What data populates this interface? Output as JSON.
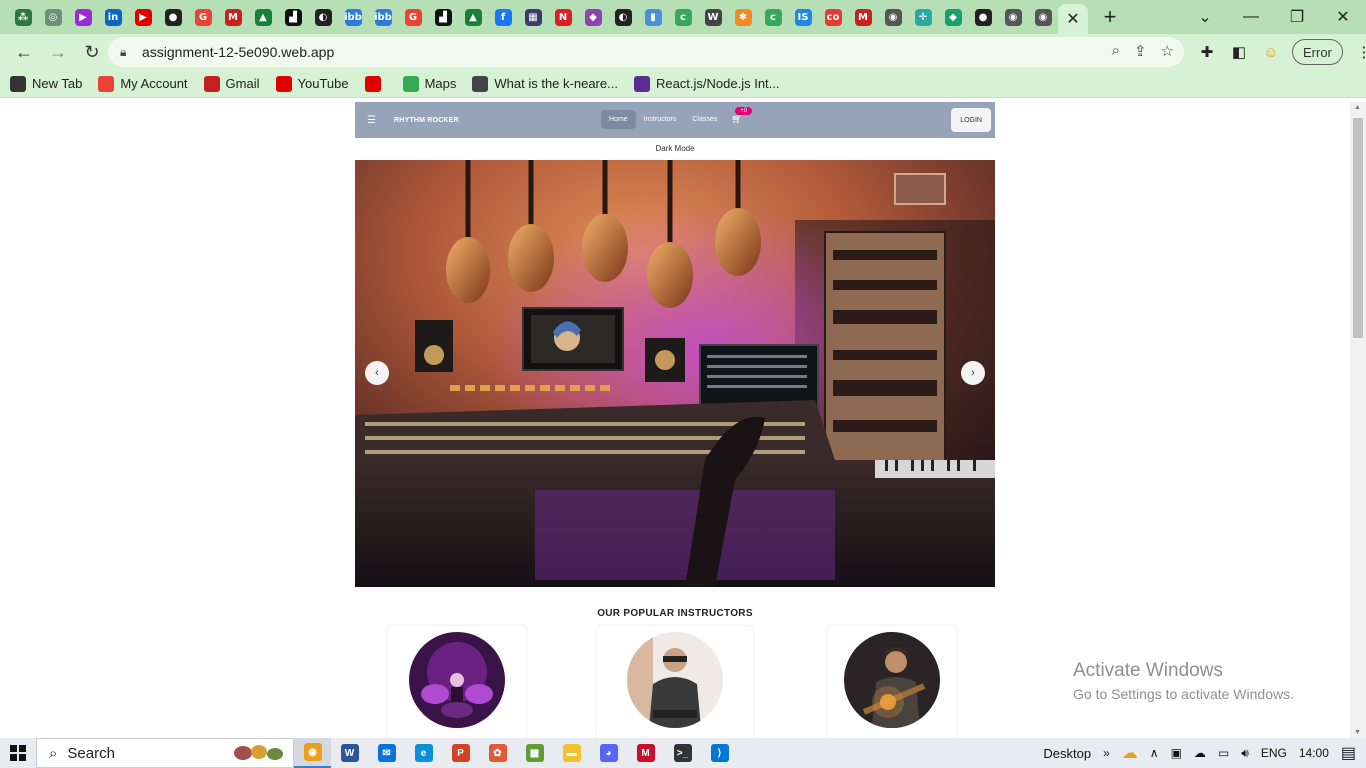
{
  "browser": {
    "tabs_favicons": [
      {
        "name": "ai-tab-icon",
        "color": "#2b7a3d",
        "glyph": "⁂"
      },
      {
        "name": "chatgpt-tab-icon",
        "color": "#6b8f78",
        "glyph": "◎"
      },
      {
        "name": "media-tab-icon",
        "color": "#9b2bd6",
        "glyph": "▶"
      },
      {
        "name": "linkedin-tab-icon",
        "color": "#0a66c2",
        "glyph": "in"
      },
      {
        "name": "youtube-tab-icon",
        "color": "#e00000",
        "glyph": "▶"
      },
      {
        "name": "github-tab-icon",
        "color": "#222222",
        "glyph": "●"
      },
      {
        "name": "google-tab-icon",
        "color": "#ea4335",
        "glyph": "G"
      },
      {
        "name": "gmail-tab-icon",
        "color": "#c5221f",
        "glyph": "M"
      },
      {
        "name": "drive-tab-icon",
        "color": "#188038",
        "glyph": "▲"
      },
      {
        "name": "tab-icon-9",
        "color": "#111111",
        "glyph": "▟"
      },
      {
        "name": "tab-icon-10",
        "color": "#222222",
        "glyph": "◐"
      },
      {
        "name": "imgbb-tab-icon",
        "color": "#2d7be0",
        "glyph": "ibb"
      },
      {
        "name": "imgbb-tab-icon-2",
        "color": "#2d7be0",
        "glyph": "ibb"
      },
      {
        "name": "google-tab-icon-2",
        "color": "#ea4335",
        "glyph": "G"
      },
      {
        "name": "tab-icon-14",
        "color": "#111111",
        "glyph": "▟"
      },
      {
        "name": "drive-tab-icon-2",
        "color": "#188038",
        "glyph": "▲"
      },
      {
        "name": "facebook-tab-icon",
        "color": "#1877f2",
        "glyph": "f"
      },
      {
        "name": "tab-icon-17",
        "color": "#3c3c6a",
        "glyph": "▦"
      },
      {
        "name": "netflix-tab-icon",
        "color": "#d81f26",
        "glyph": "N"
      },
      {
        "name": "tab-icon-19",
        "color": "#8e44ad",
        "glyph": "◆"
      },
      {
        "name": "tab-icon-20",
        "color": "#222222",
        "glyph": "◐"
      },
      {
        "name": "tab-icon-21",
        "color": "#4a90d9",
        "glyph": "▮"
      },
      {
        "name": "tab-icon-22",
        "color": "#3aa55d",
        "glyph": "c"
      },
      {
        "name": "tab-icon-23",
        "color": "#444444",
        "glyph": "W"
      },
      {
        "name": "tab-icon-24",
        "color": "#f08a24",
        "glyph": "✱"
      },
      {
        "name": "tab-icon-25",
        "color": "#3aa55d",
        "glyph": "c"
      },
      {
        "name": "tab-icon-26",
        "color": "#1e88e5",
        "glyph": "IS"
      },
      {
        "name": "tab-icon-27",
        "color": "#e53935",
        "glyph": "co"
      },
      {
        "name": "gmail-tab-icon-2",
        "color": "#c5221f",
        "glyph": "M"
      },
      {
        "name": "tab-icon-29",
        "color": "#555555",
        "glyph": "◉"
      },
      {
        "name": "tab-icon-30",
        "color": "#2aa7a0",
        "glyph": "✛"
      },
      {
        "name": "tab-icon-31",
        "color": "#18a06a",
        "glyph": "◆"
      },
      {
        "name": "github-tab-icon-2",
        "color": "#222222",
        "glyph": "●"
      },
      {
        "name": "tab-icon-33",
        "color": "#555555",
        "glyph": "◉"
      },
      {
        "name": "tab-icon-34",
        "color": "#555555",
        "glyph": "◉"
      }
    ],
    "active_tab_close": "✕",
    "new_tab": "+",
    "url": "assignment-12-5e090.web.app",
    "error_label": "Error",
    "bookmarks": [
      {
        "label": "New Tab",
        "icon": "globe-icon",
        "color": "#333333"
      },
      {
        "label": "My Account",
        "icon": "google-icon",
        "color": "#ea4335"
      },
      {
        "label": "Gmail",
        "icon": "gmail-icon",
        "color": "#c5221f"
      },
      {
        "label": "YouTube",
        "icon": "youtube-icon",
        "color": "#e00000"
      },
      {
        "label": "",
        "icon": "youtube-icon",
        "color": "#e00000"
      },
      {
        "label": "Maps",
        "icon": "maps-icon",
        "color": "#34a853"
      },
      {
        "label": "What is the k-neare...",
        "icon": "tool-icon",
        "color": "#444444"
      },
      {
        "label": "React.js/Node.js Int...",
        "icon": "list-icon",
        "color": "#5c2d91"
      }
    ]
  },
  "site": {
    "brand": "RHYTHM ROCKER",
    "nav": [
      {
        "label": "Home",
        "active": true
      },
      {
        "label": "Instructors",
        "active": false
      },
      {
        "label": "Classes",
        "active": false
      }
    ],
    "cart_badge": "+0",
    "login": "LOGIN",
    "dark_mode": "Dark Mode",
    "carousel_prev": "‹",
    "carousel_next": "›",
    "popular_title": "OUR POPULAR INSTRUCTORS"
  },
  "watermark": {
    "line1": "Activate Windows",
    "line2": "Go to Settings to activate Windows."
  },
  "taskbar": {
    "search": "Search",
    "apps": [
      {
        "name": "chrome-taskbar-icon",
        "color": "#e8a11c",
        "glyph": "◉",
        "active": true
      },
      {
        "name": "word-taskbar-icon",
        "color": "#2b579a",
        "glyph": "W",
        "active": false
      },
      {
        "name": "mail-taskbar-icon",
        "color": "#0a74da",
        "glyph": "✉",
        "active": false
      },
      {
        "name": "edge-taskbar-icon",
        "color": "#0c8fd6",
        "glyph": "e",
        "active": false
      },
      {
        "name": "powerpoint-taskbar-icon",
        "color": "#d04423",
        "glyph": "P",
        "active": false
      },
      {
        "name": "photos-taskbar-icon",
        "color": "#e05a3a",
        "glyph": "✿",
        "active": false
      },
      {
        "name": "store-taskbar-icon",
        "color": "#5e9c34",
        "glyph": "▦",
        "active": false
      },
      {
        "name": "explorer-taskbar-icon",
        "color": "#f2c12e",
        "glyph": "▬",
        "active": false
      },
      {
        "name": "discord-taskbar-icon",
        "color": "#5865f2",
        "glyph": "◕",
        "active": false
      },
      {
        "name": "mcafee-taskbar-icon",
        "color": "#c8102e",
        "glyph": "M",
        "active": false
      },
      {
        "name": "terminal-taskbar-icon",
        "color": "#333333",
        "glyph": ">_",
        "active": false
      },
      {
        "name": "vscode-taskbar-icon",
        "color": "#0078d4",
        "glyph": "⟩",
        "active": false
      }
    ],
    "desktop": "Desktop",
    "lang": "ENG",
    "time": "14:00"
  }
}
